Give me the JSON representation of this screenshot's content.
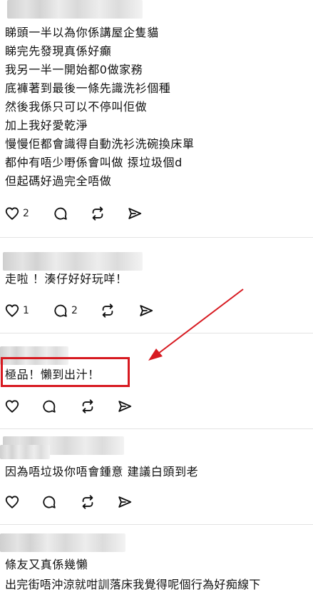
{
  "posts": [
    {
      "lines": [
        "睇頭一半以為你係講屋企隻貓",
        "睇完先發現真係好癲",
        "我另一半一開始都0做家務",
        "底褲著到最後一條先識洗衫個種",
        "然後我係只可以不停叫佢做",
        "加上我好愛乾淨",
        "￼慢慢佢都會識得自動洗衫洗碗換床單",
        "都仲有唔少嘢係會叫做 揼垃圾個d",
        "但起碼好過完全唔做"
      ],
      "likes": "2",
      "replies": ""
    },
    {
      "lines": [
        "走啦 ！湊仔好好玩咩！"
      ],
      "likes": "1",
      "replies": "2"
    },
    {
      "lines": [
        "極品！￼懶到出汁！"
      ],
      "likes": "",
      "replies": ""
    },
    {
      "lines": [
        "因為唔垃圾你唔會鍾意 建議白頭到老"
      ],
      "likes": "",
      "replies": ""
    },
    {
      "lines": [
        "條友又真係幾懶",
        "出完街唔沖涼就咁訓落床我覺得呢個行為好痴線下"
      ],
      "likes": "",
      "replies": ""
    }
  ],
  "icons": [
    "heart-icon",
    "reply-icon",
    "repost-icon",
    "share-icon"
  ],
  "colors": {
    "annotation": "#d71920",
    "text": "#111111",
    "divider": "#e3e3e3"
  }
}
